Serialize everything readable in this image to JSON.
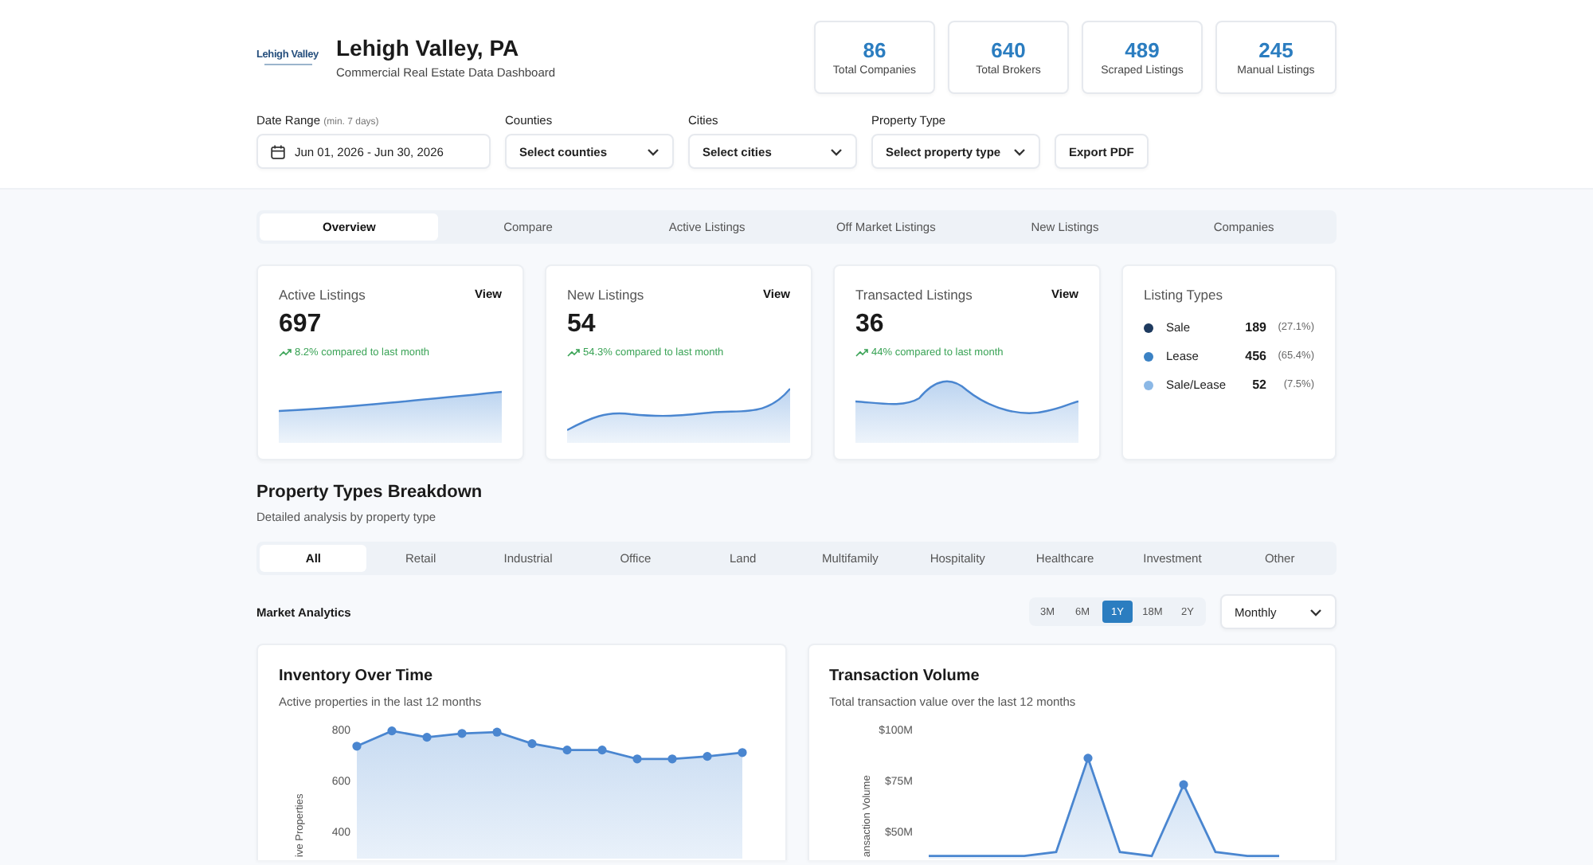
{
  "header": {
    "logo": "Lehigh Valley",
    "title": "Lehigh Valley, PA",
    "subtitle": "Commercial Real Estate Data Dashboard"
  },
  "stats": [
    {
      "value": "86",
      "label": "Total Companies"
    },
    {
      "value": "640",
      "label": "Total Brokers"
    },
    {
      "value": "489",
      "label": "Scraped Listings"
    },
    {
      "value": "245",
      "label": "Manual Listings"
    }
  ],
  "filters": {
    "date_range": {
      "label": "Date Range",
      "hint": "(min. 7 days)",
      "value": "Jun 01, 2026 - Jun 30, 2026"
    },
    "dropdowns": [
      {
        "label": "Counties",
        "value": "Select counties"
      },
      {
        "label": "Cities",
        "value": "Select cities"
      },
      {
        "label": "Property Type",
        "value": "Select property type"
      }
    ],
    "export_button": "Export PDF"
  },
  "tabs": [
    {
      "label": "Overview",
      "selected": true
    },
    {
      "label": "Compare",
      "selected": false
    },
    {
      "label": "Active Listings",
      "selected": false
    },
    {
      "label": "Off Market Listings",
      "selected": false
    },
    {
      "label": "New Listings",
      "selected": false
    },
    {
      "label": "Companies",
      "selected": false
    }
  ],
  "metric_cards": [
    {
      "title": "Active Listings",
      "action": "View",
      "value": "697",
      "change": "8.2% compared to last month"
    },
    {
      "title": "New Listings",
      "action": "View",
      "value": "54",
      "change": "54.3% compared to last month"
    },
    {
      "title": "Transacted Listings",
      "action": "View",
      "value": "36",
      "change": "44% compared to last month"
    }
  ],
  "listing_types": {
    "title": "Listing Types",
    "items": [
      {
        "name": "Sale",
        "count": "189",
        "share": "(27.1%)",
        "color": "#1e3a5f"
      },
      {
        "name": "Lease",
        "count": "456",
        "share": "(65.4%)",
        "color": "#3b82c4"
      },
      {
        "name": "Sale/Lease",
        "count": "52",
        "share": "(7.5%)",
        "color": "#8bb8e6"
      }
    ]
  },
  "breakdown": {
    "title": "Property Types Breakdown",
    "subtitle": "Detailed analysis by property type",
    "types": [
      {
        "label": "All",
        "selected": true
      },
      {
        "label": "Retail",
        "selected": false
      },
      {
        "label": "Industrial",
        "selected": false
      },
      {
        "label": "Office",
        "selected": false
      },
      {
        "label": "Land",
        "selected": false
      },
      {
        "label": "Multifamily",
        "selected": false
      },
      {
        "label": "Hospitality",
        "selected": false
      },
      {
        "label": "Healthcare",
        "selected": false
      },
      {
        "label": "Investment",
        "selected": false
      },
      {
        "label": "Other",
        "selected": false
      }
    ]
  },
  "market_analytics": {
    "title": "Market Analytics",
    "periods": [
      {
        "label": "3M",
        "selected": false
      },
      {
        "label": "6M",
        "selected": false
      },
      {
        "label": "1Y",
        "selected": true
      },
      {
        "label": "18M",
        "selected": false
      },
      {
        "label": "2Y",
        "selected": false
      }
    ],
    "interval": "Monthly"
  },
  "charts": [
    {
      "title": "Inventory Over Time",
      "subtitle": "Active properties in the last 12 months",
      "chart_data": {
        "type": "area",
        "ylabel": "ive Properties",
        "categories": [
          null,
          null,
          null,
          null,
          null,
          null,
          null,
          null,
          null,
          null,
          null,
          null
        ],
        "ylim": [
          0,
          800
        ],
        "yticks": [
          800,
          600,
          400
        ],
        "series": [
          {
            "color": "#4a86d0",
            "values": [
              735,
              795,
              770,
              785,
              790,
              745,
              720,
              720,
              685,
              685,
              695,
              710
            ]
          }
        ]
      }
    },
    {
      "title": "Transaction Volume",
      "subtitle": "Total transaction value over the last 12 months",
      "chart_data": {
        "type": "area",
        "ylabel": "ansaction Volume",
        "categories": [
          null,
          null,
          null,
          null,
          null,
          null,
          null,
          null,
          null,
          null,
          null,
          null
        ],
        "ylim": [
          0,
          100
        ],
        "yticks": [
          {
            "value": 100,
            "label": "$100M"
          },
          {
            "value": 75,
            "label": "$75M"
          },
          {
            "value": 50,
            "label": "$50M"
          }
        ],
        "series": [
          {
            "color": "#4a86d0",
            "values": [
              38,
              38,
              38,
              38,
              40,
              86,
              40,
              38,
              73,
              40,
              38,
              38
            ]
          }
        ]
      }
    }
  ]
}
